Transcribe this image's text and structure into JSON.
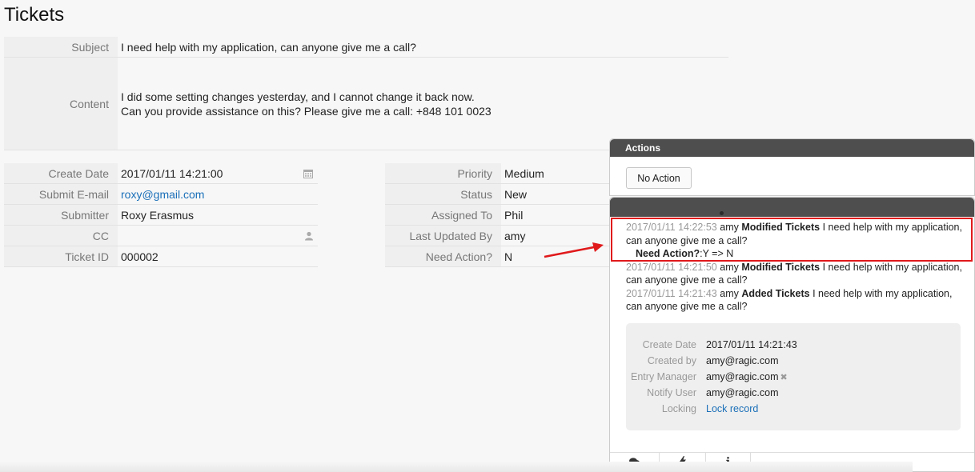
{
  "page": {
    "title": "Tickets"
  },
  "ticket": {
    "subject_label": "Subject",
    "subject": "I need help with my application, can anyone give me a call?",
    "content_label": "Content",
    "content_line1": "I did some setting changes yesterday, and I cannot change it back now.",
    "content_line2": "Can you provide assistance on this? Please give me a call: +848 101 0023"
  },
  "left_fields": [
    {
      "label": "Create Date",
      "value": "2017/01/11 14:21:00",
      "icon": "calendar-icon"
    },
    {
      "label": "Submit E-mail",
      "value": "roxy@gmail.com"
    },
    {
      "label": "Submitter",
      "value": "Roxy Erasmus"
    },
    {
      "label": "CC",
      "value": "",
      "icon": "user-icon"
    },
    {
      "label": "Ticket ID",
      "value": "000002"
    }
  ],
  "right_fields": [
    {
      "label": "Priority",
      "value": "Medium"
    },
    {
      "label": "Status",
      "value": "New"
    },
    {
      "label": "Assigned To",
      "value": "Phil"
    },
    {
      "label": "Last Updated By",
      "value": "amy"
    },
    {
      "label": "Need Action?",
      "value": "N"
    }
  ],
  "actions": {
    "header": "Actions",
    "button_label": "No Action"
  },
  "history": [
    {
      "timestamp": "2017/01/11 14:22:53",
      "user": "amy",
      "action": "Modified Tickets",
      "text": "I need help with my application, can anyone give me a call?",
      "detail_label": "Need Action?",
      "detail_change": ":Y => N"
    },
    {
      "timestamp": "2017/01/11 14:21:50",
      "user": "amy",
      "action": "Modified Tickets",
      "text": "I need help with my application, can anyone give me a call?"
    },
    {
      "timestamp": "2017/01/11 14:21:43",
      "user": "amy",
      "action": "Added Tickets",
      "text": "I need help with my application, can anyone give me a call?"
    }
  ],
  "record_info": {
    "create_date_label": "Create Date",
    "create_date": "2017/01/11 14:21:43",
    "created_by_label": "Created by",
    "created_by": "amy@ragic.com",
    "entry_manager_label": "Entry Manager",
    "entry_manager": "amy@ragic.com",
    "notify_user_label": "Notify User",
    "notify_user": "amy@ragic.com",
    "locking_label": "Locking",
    "locking_link": "Lock record",
    "remove_mark": "✖"
  },
  "tabs": [
    {
      "icon": "comments-icon"
    },
    {
      "icon": "lightning-icon"
    },
    {
      "icon": "info-icon"
    }
  ],
  "colors": {
    "highlight": "#e0191b",
    "link": "#1a6fb8",
    "panel_header": "#4e4e4e"
  }
}
